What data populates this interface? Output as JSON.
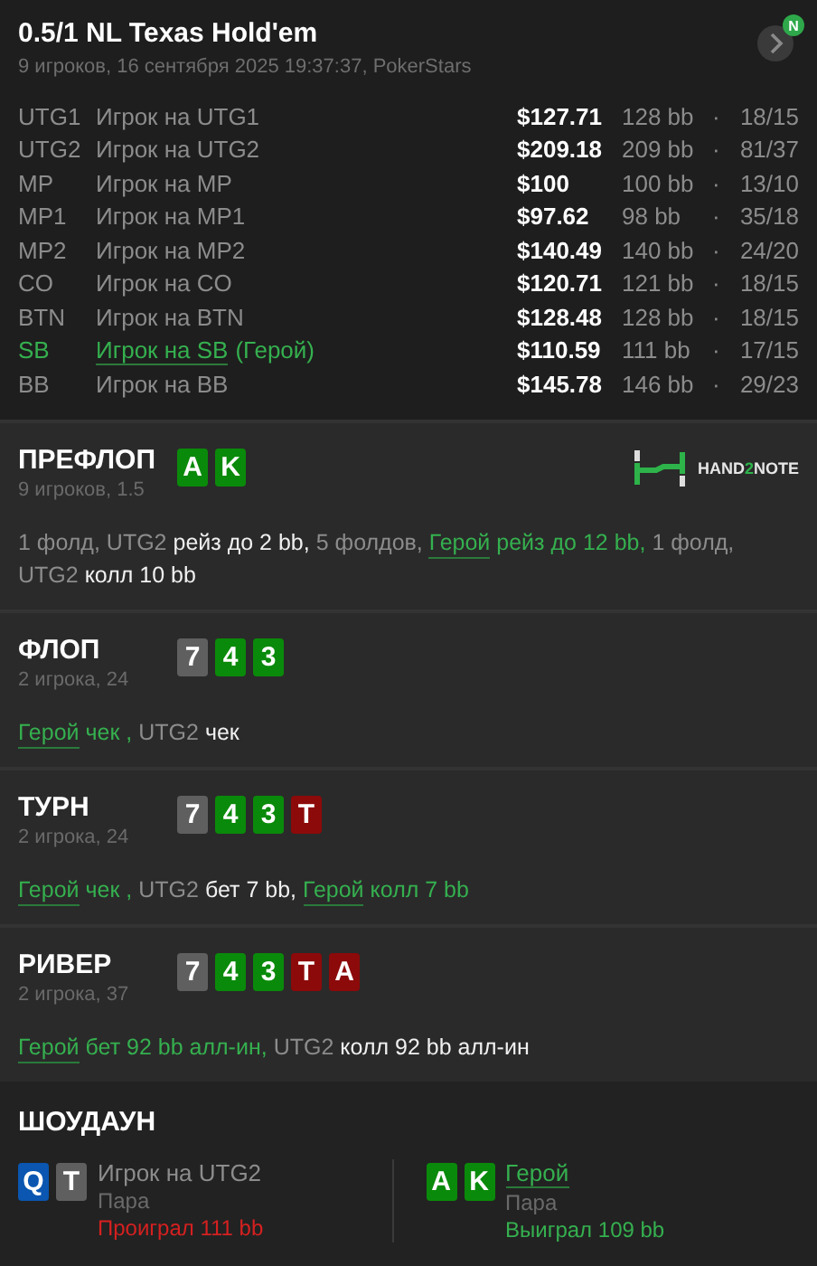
{
  "header": {
    "title": "0.5/1 NL Texas Hold'em",
    "subtitle": "9 игроков, 16 сентября 2025 19:37:37, PokerStars",
    "next_badge": "N"
  },
  "players": [
    {
      "position": "UTG1",
      "name": "Игрок на UTG1",
      "hero": false,
      "stack": "$127.71",
      "bb": "128 bb",
      "dot": "·",
      "stats": "18/15"
    },
    {
      "position": "UTG2",
      "name": "Игрок на UTG2",
      "hero": false,
      "stack": "$209.18",
      "bb": "209 bb",
      "dot": "·",
      "stats": "81/37"
    },
    {
      "position": "MP",
      "name": "Игрок на MP",
      "hero": false,
      "stack": "$100",
      "bb": "100 bb",
      "dot": "·",
      "stats": "13/10"
    },
    {
      "position": "MP1",
      "name": "Игрок на MP1",
      "hero": false,
      "stack": "$97.62",
      "bb": "98 bb",
      "dot": "·",
      "stats": "35/18"
    },
    {
      "position": "MP2",
      "name": "Игрок на MP2",
      "hero": false,
      "stack": "$140.49",
      "bb": "140 bb",
      "dot": "·",
      "stats": "24/20"
    },
    {
      "position": "CO",
      "name": "Игрок на CO",
      "hero": false,
      "stack": "$120.71",
      "bb": "121 bb",
      "dot": "·",
      "stats": "18/15"
    },
    {
      "position": "BTN",
      "name": "Игрок на BTN",
      "hero": false,
      "stack": "$128.48",
      "bb": "128 bb",
      "dot": "·",
      "stats": "18/15"
    },
    {
      "position": "SB",
      "name": "Игрок на SB",
      "hero": true,
      "hero_tag": "(Герой)",
      "stack": "$110.59",
      "bb": "111 bb",
      "dot": "·",
      "stats": "17/15"
    },
    {
      "position": "BB",
      "name": "Игрок на BB",
      "hero": false,
      "stack": "$145.78",
      "bb": "146 bb",
      "dot": "·",
      "stats": "29/23"
    }
  ],
  "streets": [
    {
      "name": "ПРЕФЛОП",
      "info": "9 игроков, 1.5",
      "logo": {
        "before": "HAND",
        "mid": "2",
        "after": "NOTE"
      },
      "cards": [
        {
          "rank": "A",
          "color": "#0a8a0a"
        },
        {
          "rank": "K",
          "color": "#0a8a0a"
        }
      ],
      "segments": [
        {
          "kind": "muted",
          "text": "1 фолд, UTG2"
        },
        {
          "kind": "action",
          "text": "рейз до 2 bb,"
        },
        {
          "kind": "muted",
          "text": "5 фолдов,"
        },
        {
          "kind": "hero",
          "text": "Герой"
        },
        {
          "kind": "hero_action",
          "text": "рейз до 12 bb,"
        },
        {
          "kind": "muted",
          "text": "1 фолд,"
        },
        {
          "kind": "muted",
          "text": "UTG2"
        },
        {
          "kind": "action",
          "text": "колл 10 bb"
        }
      ]
    },
    {
      "name": "ФЛОП",
      "info": "2 игрока, 24",
      "cards": [
        {
          "rank": "7",
          "color": "#5f5f5f"
        },
        {
          "rank": "4",
          "color": "#0a8a0a"
        },
        {
          "rank": "3",
          "color": "#0a8a0a"
        }
      ],
      "segments": [
        {
          "kind": "hero",
          "text": "Герой"
        },
        {
          "kind": "hero_action",
          "text": "чек ,"
        },
        {
          "kind": "muted",
          "text": "UTG2"
        },
        {
          "kind": "action",
          "text": "чек"
        }
      ]
    },
    {
      "name": "ТУРН",
      "info": "2 игрока, 24",
      "cards": [
        {
          "rank": "7",
          "color": "#5f5f5f"
        },
        {
          "rank": "4",
          "color": "#0a8a0a"
        },
        {
          "rank": "3",
          "color": "#0a8a0a"
        },
        {
          "rank": "T",
          "color": "#8c0a0a"
        }
      ],
      "segments": [
        {
          "kind": "hero",
          "text": "Герой"
        },
        {
          "kind": "hero_action",
          "text": "чек ,"
        },
        {
          "kind": "muted",
          "text": "UTG2"
        },
        {
          "kind": "action",
          "text": "бет 7 bb,"
        },
        {
          "kind": "hero",
          "text": "Герой"
        },
        {
          "kind": "hero_action",
          "text": "колл 7 bb"
        }
      ]
    },
    {
      "name": "РИВЕР",
      "info": "2 игрока, 37",
      "cards": [
        {
          "rank": "7",
          "color": "#5f5f5f"
        },
        {
          "rank": "4",
          "color": "#0a8a0a"
        },
        {
          "rank": "3",
          "color": "#0a8a0a"
        },
        {
          "rank": "T",
          "color": "#8c0a0a"
        },
        {
          "rank": "A",
          "color": "#8c0a0a"
        }
      ],
      "segments": [
        {
          "kind": "hero",
          "text": "Герой"
        },
        {
          "kind": "hero_action",
          "text": "бет 92 bb алл-ин,"
        },
        {
          "kind": "muted",
          "text": "UTG2"
        },
        {
          "kind": "action",
          "text": "колл 92 bb алл-ин"
        }
      ]
    }
  ],
  "showdown": {
    "title": "ШОУДАУН",
    "hands": [
      {
        "player": "Игрок на UTG2",
        "hero": false,
        "hand": "Пара",
        "result": "Проиграл 111 bb",
        "won": false,
        "cards": [
          {
            "rank": "Q",
            "color": "#0a56b0"
          },
          {
            "rank": "T",
            "color": "#5f5f5f"
          }
        ]
      },
      {
        "player": "Герой",
        "hero": true,
        "hand": "Пара",
        "result": "Выиграл 109 bb",
        "won": true,
        "cards": [
          {
            "rank": "A",
            "color": "#0a8a0a"
          },
          {
            "rank": "K",
            "color": "#0a8a0a"
          }
        ]
      }
    ]
  }
}
